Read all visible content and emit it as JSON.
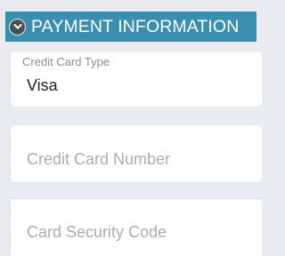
{
  "header": {
    "title": "PAYMENT INFORMATION",
    "toggle_icon": "chevron-down-icon"
  },
  "fields": {
    "card_type": {
      "label": "Credit Card Type",
      "value": "Visa"
    },
    "card_number": {
      "placeholder": "Credit Card Number",
      "value": ""
    },
    "security_code": {
      "placeholder": "Card Security Code",
      "value": ""
    }
  },
  "colors": {
    "header_bg": "#3a8fb0",
    "header_text": "#ffffff",
    "field_bg": "#ffffff",
    "placeholder_text": "#a9adb2"
  }
}
